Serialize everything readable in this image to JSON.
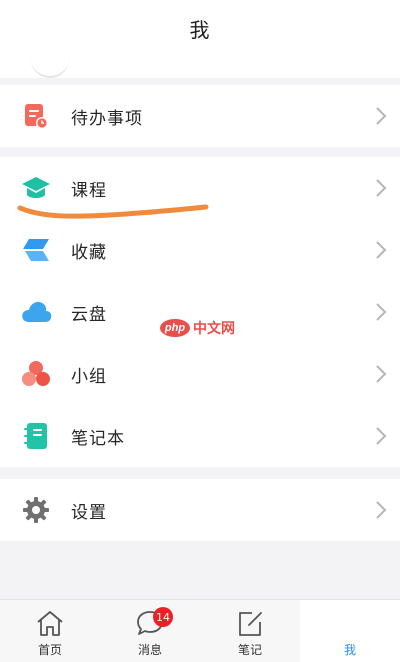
{
  "header": {
    "title": "我"
  },
  "groups": [
    {
      "items": [
        {
          "label": "待办事项",
          "icon": "todo-list-icon"
        }
      ]
    },
    {
      "items": [
        {
          "label": "课程",
          "icon": "graduation-cap-icon"
        },
        {
          "label": "收藏",
          "icon": "favorites-stack-icon"
        },
        {
          "label": "云盘",
          "icon": "cloud-icon"
        },
        {
          "label": "小组",
          "icon": "group-circles-icon"
        },
        {
          "label": "笔记本",
          "icon": "notebook-icon"
        }
      ]
    },
    {
      "items": [
        {
          "label": "设置",
          "icon": "gear-icon"
        }
      ]
    }
  ],
  "watermark": {
    "badge": "php",
    "text": "中文网"
  },
  "tabbar": {
    "tabs": [
      {
        "label": "首页",
        "icon": "home-icon"
      },
      {
        "label": "消息",
        "icon": "chat-bubble-icon",
        "badge": "14"
      },
      {
        "label": "笔记",
        "icon": "edit-note-icon"
      },
      {
        "label": "我",
        "icon": "profile-icon",
        "active": true
      }
    ]
  },
  "colors": {
    "accent": "#2b8df0",
    "badge": "#ee1f24",
    "annotation": "#f08a3c",
    "todo_icon": "#f26a5c",
    "course_icon": "#1fc0a3",
    "favorites_icon": "#2f9af0",
    "cloud_icon": "#3ba6ee",
    "group_icon": "#f26a5c",
    "notebook_icon": "#22c4a8",
    "settings_icon": "#707070"
  }
}
